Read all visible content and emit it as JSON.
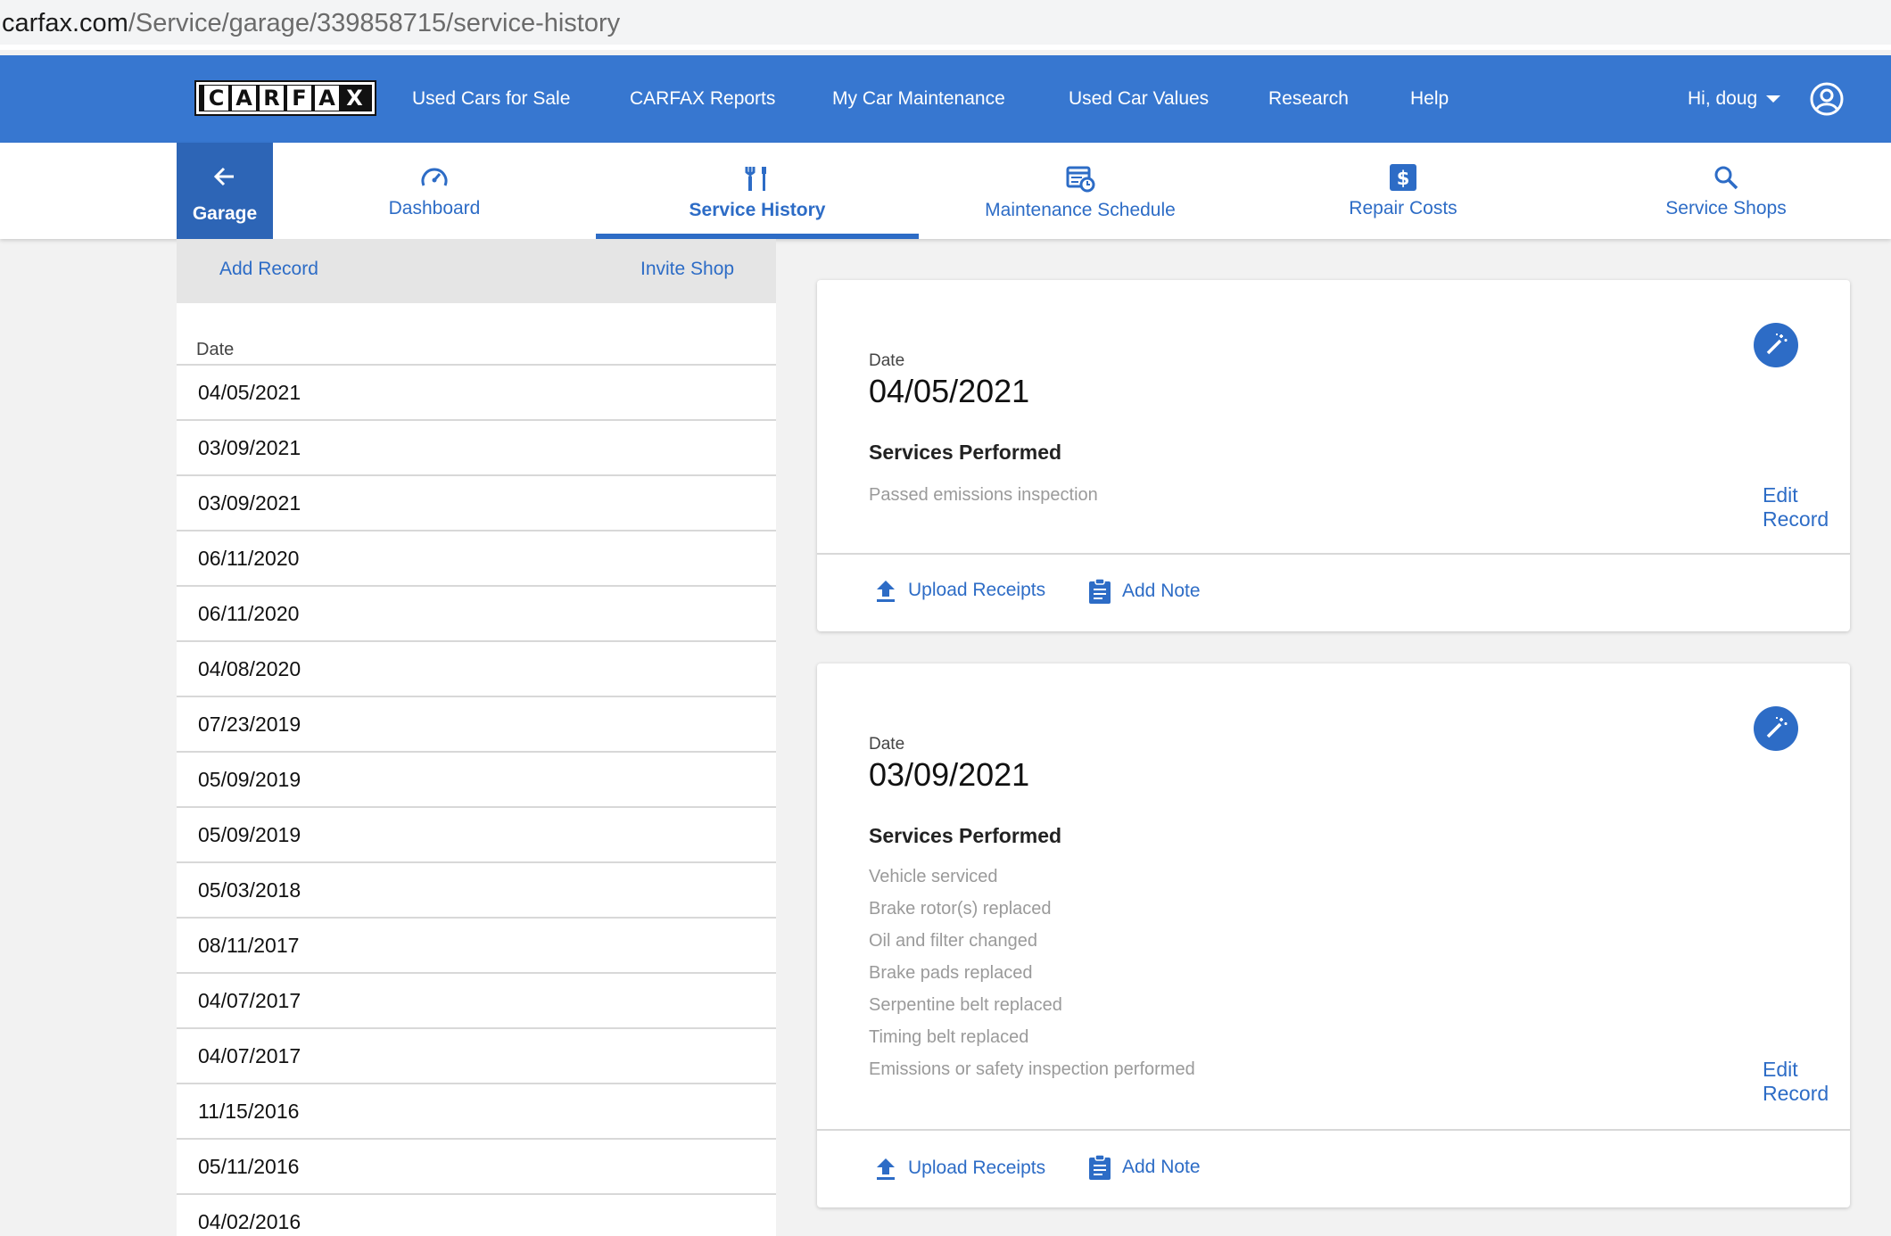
{
  "browser": {
    "url_host": "carfax.com",
    "url_path": "/Service/garage/339858715/service-history"
  },
  "brand": {
    "logo_letters": [
      "C",
      "A",
      "R",
      "F",
      "A",
      "X"
    ],
    "accent": "#3777d0",
    "dark_accent": "#2d65b6"
  },
  "topnav": {
    "links": [
      "Used Cars for Sale",
      "CARFAX Reports",
      "My Car Maintenance",
      "Used Car Values",
      "Research",
      "Help"
    ],
    "greeting": "Hi, doug",
    "user_icon": "account-circle-icon"
  },
  "subnav": {
    "back": {
      "label": "Garage",
      "icon": "arrow-left-icon"
    },
    "tabs": [
      {
        "label": "Dashboard",
        "icon": "speedometer-icon"
      },
      {
        "label": "Service History",
        "icon": "tools-icon",
        "active": true
      },
      {
        "label": "Maintenance Schedule",
        "icon": "calendar-clock-icon"
      },
      {
        "label": "Repair Costs",
        "icon": "dollar-icon"
      },
      {
        "label": "Service Shops",
        "icon": "search-icon"
      }
    ]
  },
  "records_list": {
    "add_record": "Add Record",
    "invite_shop": "Invite Shop",
    "header": "Date",
    "dates": [
      "04/05/2021",
      "03/09/2021",
      "03/09/2021",
      "06/11/2020",
      "06/11/2020",
      "04/08/2020",
      "07/23/2019",
      "05/09/2019",
      "05/09/2019",
      "05/03/2018",
      "08/11/2017",
      "04/07/2017",
      "04/07/2017",
      "11/15/2016",
      "05/11/2016",
      "04/02/2016"
    ]
  },
  "cards": [
    {
      "date_label": "Date",
      "date": "04/05/2021",
      "services_title": "Services Performed",
      "services": [
        "Passed emissions inspection"
      ],
      "edit_label": "Edit Record",
      "upload_label": "Upload Receipts",
      "note_label": "Add Note"
    },
    {
      "date_label": "Date",
      "date": "03/09/2021",
      "services_title": "Services Performed",
      "services": [
        "Vehicle serviced",
        "Brake rotor(s) replaced",
        "Oil and filter changed",
        "Brake pads replaced",
        "Serpentine belt replaced",
        "Timing belt replaced",
        "Emissions or safety inspection performed"
      ],
      "edit_label": "Edit Record",
      "upload_label": "Upload Receipts",
      "note_label": "Add Note"
    }
  ]
}
